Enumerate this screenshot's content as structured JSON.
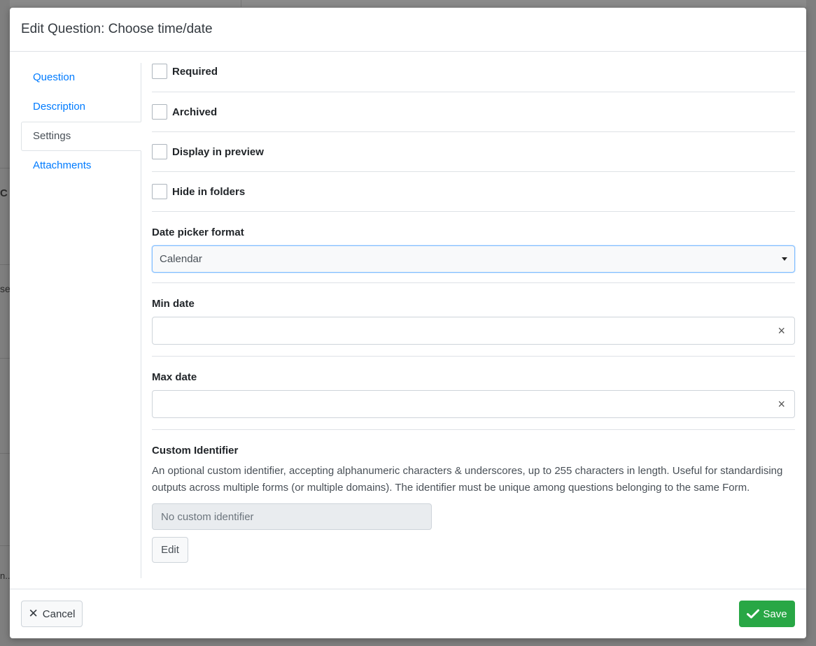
{
  "modal": {
    "title": "Edit Question: Choose time/date"
  },
  "nav": {
    "items": [
      {
        "label": "Question",
        "active": false
      },
      {
        "label": "Description",
        "active": false
      },
      {
        "label": "Settings",
        "active": true
      },
      {
        "label": "Attachments",
        "active": false
      }
    ]
  },
  "settings": {
    "checkboxes": [
      {
        "label": "Required",
        "checked": false
      },
      {
        "label": "Archived",
        "checked": false
      },
      {
        "label": "Display in preview",
        "checked": false
      },
      {
        "label": "Hide in folders",
        "checked": false
      }
    ],
    "date_picker_format": {
      "label": "Date picker format",
      "value": "Calendar"
    },
    "min_date": {
      "label": "Min date",
      "value": "",
      "clear_icon": "×"
    },
    "max_date": {
      "label": "Max date",
      "value": "",
      "clear_icon": "×"
    },
    "custom_identifier": {
      "label": "Custom Identifier",
      "help": "An optional custom identifier, accepting alphanumeric characters & underscores, up to 255 characters in length. Useful for standardising outputs across multiple forms (or multiple domains). The identifier must be unique among questions belonging to the same Form.",
      "placeholder": "No custom identifier",
      "edit_label": "Edit"
    }
  },
  "footer": {
    "cancel_label": "Cancel",
    "save_label": "Save"
  },
  "background": {
    "fragment_1": "C",
    "fragment_2": "se",
    "fragment_3": "n..."
  },
  "colors": {
    "link": "#007bff",
    "save": "#28a745",
    "focus_border": "#80bdff"
  }
}
